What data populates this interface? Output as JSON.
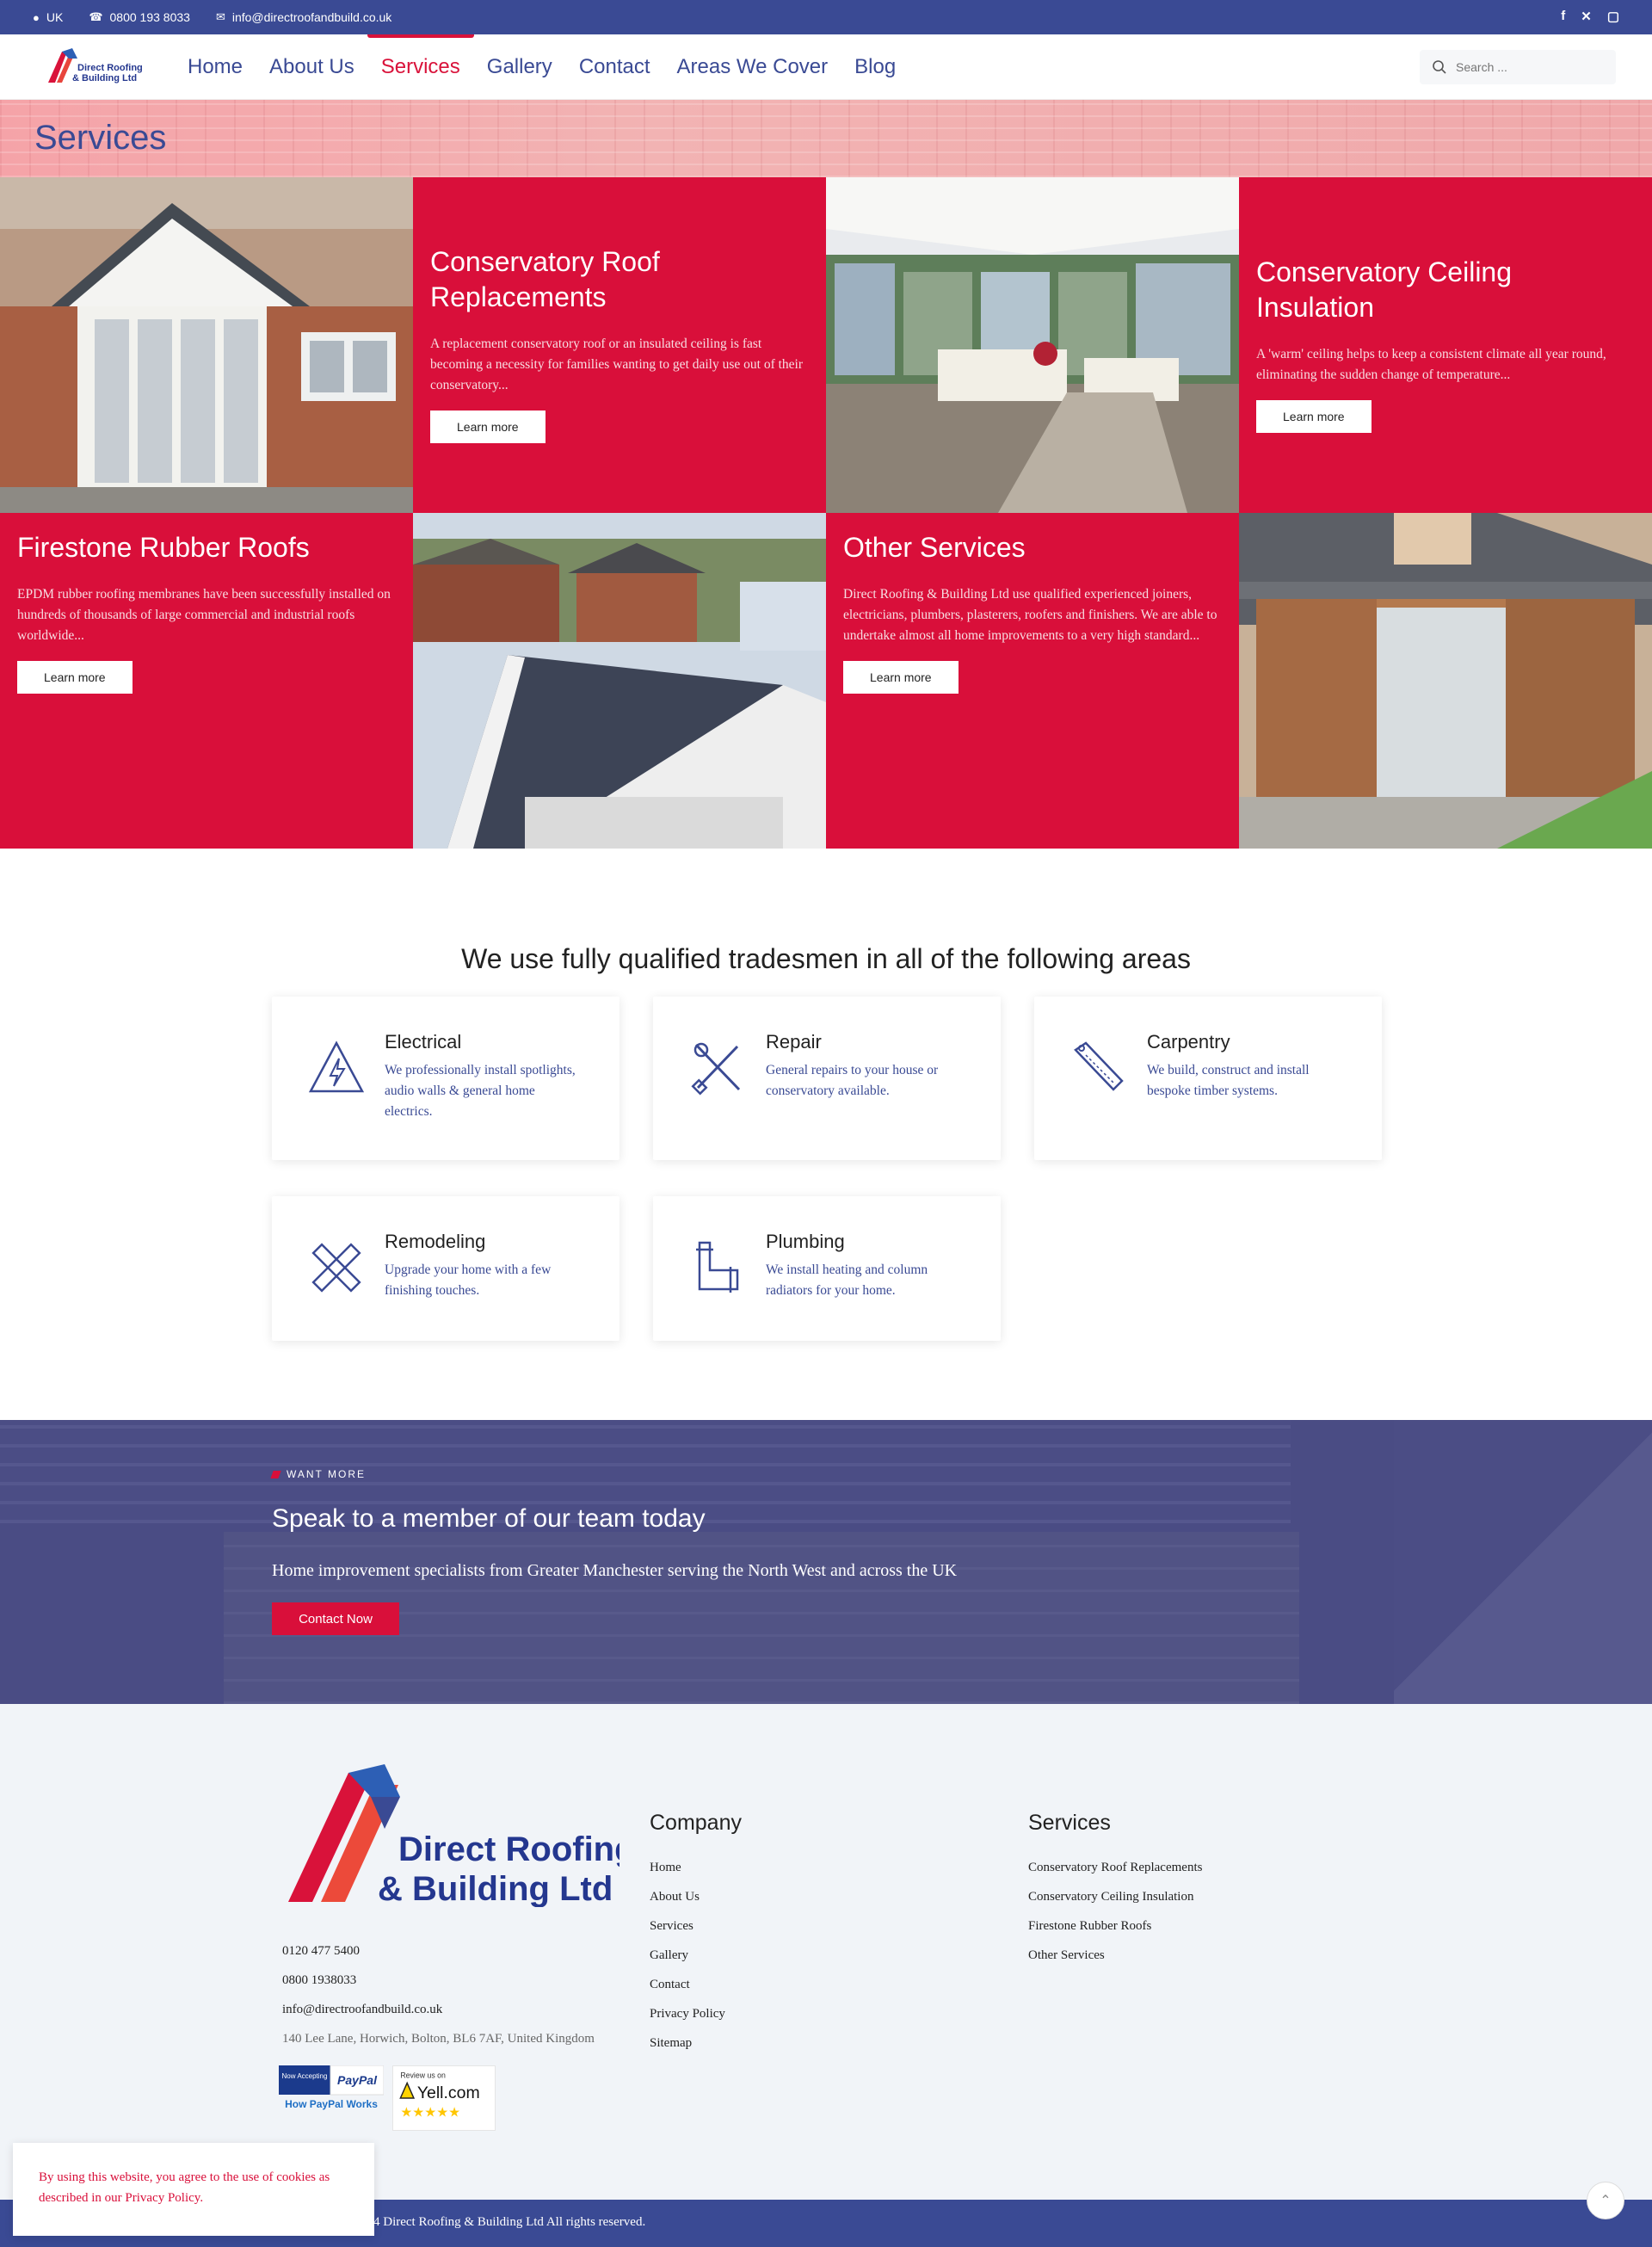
{
  "topbar": {
    "location": "UK",
    "phone": "0800 193 8033",
    "email": "info@directroofandbuild.co.uk",
    "social": [
      "facebook-icon",
      "x-icon",
      "instagram-icon"
    ]
  },
  "nav": {
    "logo_line1": "Direct Roofing",
    "logo_line2": "& Building Ltd",
    "items": [
      {
        "label": "Home"
      },
      {
        "label": "About Us"
      },
      {
        "label": "Services",
        "active": true
      },
      {
        "label": "Gallery"
      },
      {
        "label": "Contact"
      },
      {
        "label": "Areas We Cover"
      },
      {
        "label": "Blog"
      }
    ],
    "search_placeholder": "Search ..."
  },
  "page": {
    "title": "Services"
  },
  "services": [
    {
      "title": "Conservatory Roof Replacements",
      "text": "A replacement conservatory roof or an insulated ceiling is fast becoming a necessity for families wanting to get daily use out of their conservatory...",
      "button": "Learn more"
    },
    {
      "title": "Conservatory Ceiling Insulation",
      "text": "A 'warm' ceiling helps to keep a consistent climate all year round, eliminating the sudden change of temperature...",
      "button": "Learn more"
    },
    {
      "title": "Firestone Rubber Roofs",
      "text": "EPDM rubber roofing membranes have been successfully installed on hundreds of thousands of large commercial and industrial roofs worldwide...",
      "button": "Learn more"
    },
    {
      "title": "Other Services",
      "text": "Direct Roofing & Building Ltd use qualified experienced joiners, electricians, plumbers, plasterers, roofers and finishers. We are able to undertake almost all home improvements to a very high standard...",
      "button": "Learn more"
    }
  ],
  "trades": {
    "title": "We use fully qualified tradesmen in all of the following areas",
    "items": [
      {
        "title": "Electrical",
        "text": "We professionally install spotlights, audio walls & general home electrics.",
        "icon": "electrical-hazard-icon"
      },
      {
        "title": "Repair",
        "text": "General repairs to your house or conservatory available.",
        "icon": "tools-icon"
      },
      {
        "title": "Carpentry",
        "text": "We build, construct and install bespoke timber systems.",
        "icon": "saw-icon"
      },
      {
        "title": "Remodeling",
        "text": "Upgrade your home with a few finishing touches.",
        "icon": "pencil-ruler-icon"
      },
      {
        "title": "Plumbing",
        "text": "We install heating and column radiators for your home.",
        "icon": "pipe-icon"
      }
    ]
  },
  "cta": {
    "tag": "WANT MORE",
    "title": "Speak to a member of our team today",
    "text": "Home improvement specialists from Greater Manchester serving the North West and across the UK",
    "button": "Contact Now"
  },
  "footer": {
    "logo_line1": "Direct Roofing",
    "logo_line2": "& Building Ltd",
    "phone1": "0120 477 5400",
    "phone2": "0800 1938033",
    "email": "info@directroofandbuild.co.uk",
    "address": "140 Lee Lane, Horwich, Bolton, BL6 7AF, United Kingdom",
    "company_title": "Company",
    "company_links": [
      "Home",
      "About Us",
      "Services",
      "Gallery",
      "Contact",
      "Privacy Policy",
      "Sitemap"
    ],
    "services_title": "Services",
    "services_links": [
      "Conservatory Roof Replacements",
      "Conservatory Ceiling Insulation",
      "Firestone Rubber Roofs",
      "Other Services"
    ],
    "paypal_now": "Now Accepting",
    "paypal_brand": "PayPal",
    "paypal_link": "How PayPal Works",
    "yell_review": "Review us on",
    "yell_brand": "Yell.com",
    "copyright": "4 Direct Roofing & Building Ltd All rights reserved."
  },
  "cookie": {
    "text": "By using this website, you agree to the use of cookies as described in our Privacy Policy."
  },
  "colors": {
    "brand_blue": "#3a4a94",
    "brand_red": "#d90f3a"
  }
}
